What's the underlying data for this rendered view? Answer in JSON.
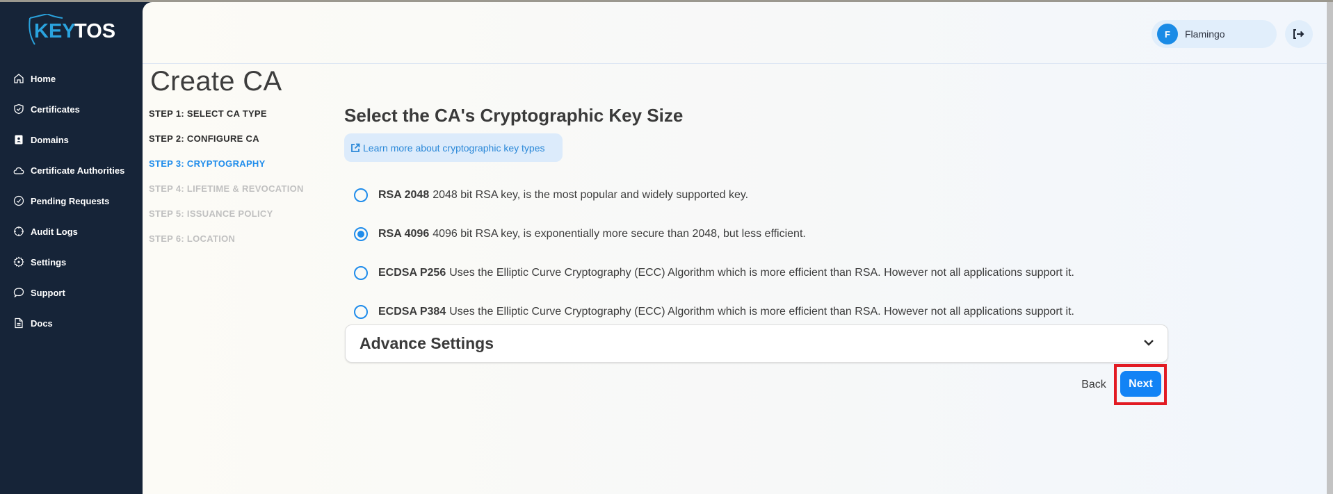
{
  "brand": {
    "name_part1": "KEY",
    "name_part2": "TOS",
    "accent": "#2aa3de"
  },
  "sidebar": {
    "items": [
      {
        "label": "Home",
        "icon": "home-icon"
      },
      {
        "label": "Certificates",
        "icon": "shield-check-icon"
      },
      {
        "label": "Domains",
        "icon": "contact-book-icon"
      },
      {
        "label": "Certificate Authorities",
        "icon": "cloud-icon"
      },
      {
        "label": "Pending Requests",
        "icon": "check-circle-icon"
      },
      {
        "label": "Audit Logs",
        "icon": "crosshair-icon"
      },
      {
        "label": "Settings",
        "icon": "gear-icon"
      },
      {
        "label": "Support",
        "icon": "chat-bubble-icon"
      },
      {
        "label": "Docs",
        "icon": "document-icon"
      }
    ]
  },
  "header": {
    "user": {
      "initial": "F",
      "name": "Flamingo"
    },
    "logout_icon": "logout-icon"
  },
  "page": {
    "title": "Create CA",
    "steps": [
      {
        "label": "STEP 1: SELECT CA TYPE",
        "state": "done"
      },
      {
        "label": "STEP 2: CONFIGURE CA",
        "state": "done"
      },
      {
        "label": "STEP 3: CRYPTOGRAPHY",
        "state": "active"
      },
      {
        "label": "STEP 4: LIFETIME & REVOCATION",
        "state": "pending"
      },
      {
        "label": "STEP 5: ISSUANCE POLICY",
        "state": "pending"
      },
      {
        "label": "STEP 6: LOCATION",
        "state": "pending"
      }
    ],
    "section_title": "Select the CA's Cryptographic Key Size",
    "learn_link": "Learn more about cryptographic key types",
    "options": [
      {
        "name": "RSA 2048",
        "description": "2048 bit RSA key, is the most popular and widely supported key.",
        "selected": false
      },
      {
        "name": "RSA 4096",
        "description": "4096 bit RSA key, is exponentially more secure than 2048, but less efficient.",
        "selected": true
      },
      {
        "name": "ECDSA P256",
        "description": "Uses the Elliptic Curve Cryptography (ECC) Algorithm which is more efficient than RSA. However not all applications support it.",
        "selected": false
      },
      {
        "name": "ECDSA P384",
        "description": "Uses the Elliptic Curve Cryptography (ECC) Algorithm which is more efficient than RSA. However not all applications support it.",
        "selected": false
      }
    ],
    "advance_settings": "Advance Settings",
    "back_label": "Back",
    "next_label": "Next"
  },
  "colors": {
    "sidebar_bg": "#162438",
    "primary": "#1283f5",
    "active_step": "#1f8ceb",
    "highlight": "#e21b23"
  }
}
